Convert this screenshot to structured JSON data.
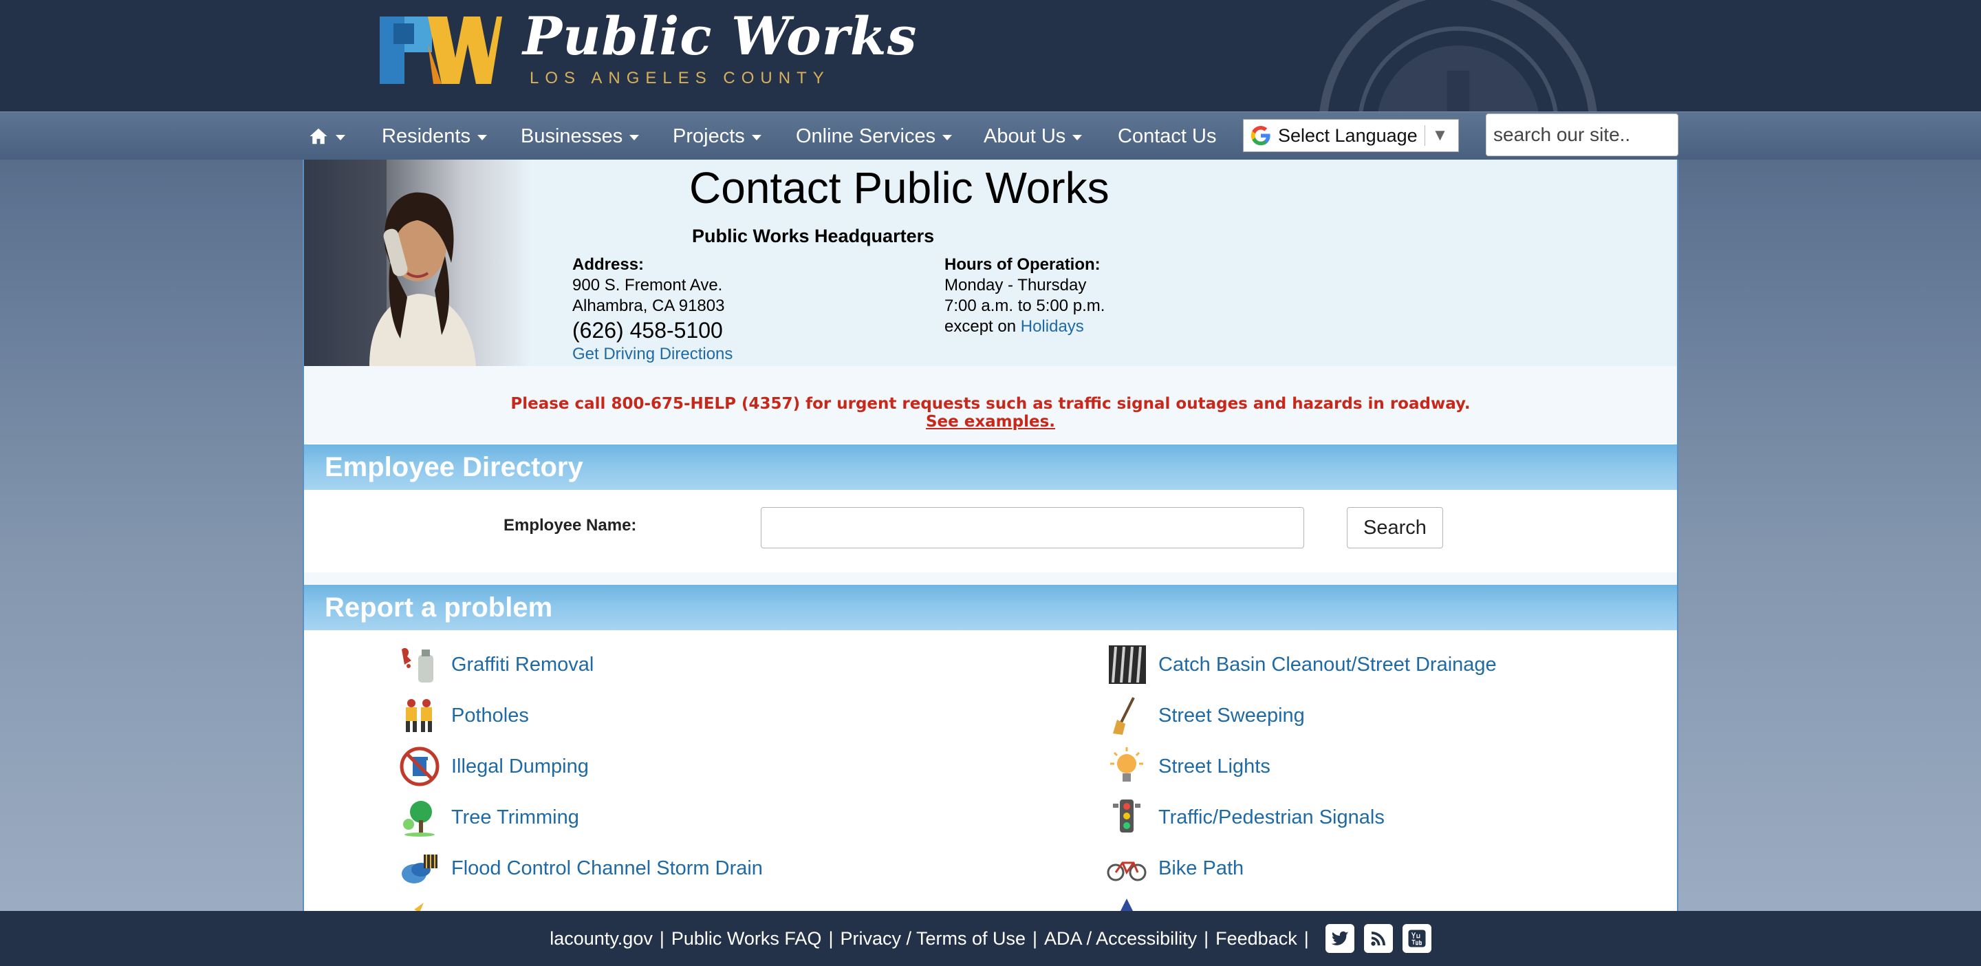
{
  "header": {
    "logo_title": "Public Works",
    "logo_subtitle": "LOS ANGELES COUNTY"
  },
  "nav": {
    "items": [
      {
        "label": "Residents"
      },
      {
        "label": "Businesses"
      },
      {
        "label": "Projects"
      },
      {
        "label": "Online Services"
      },
      {
        "label": "About Us"
      },
      {
        "label": "Contact Us"
      }
    ],
    "language_select": "Select Language",
    "search_placeholder": "search our site.."
  },
  "contact": {
    "title": "Contact Public Works",
    "hq": "Public Works Headquarters",
    "address_label": "Address:",
    "address_line1": "900 S. Fremont Ave.",
    "address_line2": "Alhambra, CA 91803",
    "phone": "(626) 458-5100",
    "directions_link": "Get Driving Directions",
    "hours_label": "Hours of Operation:",
    "hours_line1": "Monday - Thursday",
    "hours_line2": "7:00 a.m. to 5:00 p.m.",
    "hours_line3_prefix": "except on",
    "holidays_link": "Holidays"
  },
  "urgent": {
    "message": "Please call 800-675-HELP (4357) for urgent requests such as traffic signal outages and hazards in roadway.",
    "link": "See examples."
  },
  "employee_directory": {
    "heading": "Employee Directory",
    "name_label": "Employee Name:",
    "name_value": "",
    "search_button": "Search"
  },
  "report_problem": {
    "heading": "Report a problem",
    "left": [
      {
        "label": "Graffiti Removal",
        "icon": "graffiti-icon"
      },
      {
        "label": "Potholes",
        "icon": "pothole-workers-icon"
      },
      {
        "label": "Illegal Dumping",
        "icon": "no-dumping-icon"
      },
      {
        "label": "Tree Trimming",
        "icon": "tree-icon"
      },
      {
        "label": "Flood Control Channel Storm Drain",
        "icon": "storm-drain-icon"
      }
    ],
    "right": [
      {
        "label": "Catch Basin Cleanout/Street Drainage",
        "icon": "catch-basin-icon"
      },
      {
        "label": "Street Sweeping",
        "icon": "broom-icon"
      },
      {
        "label": "Street Lights",
        "icon": "light-bulb-icon"
      },
      {
        "label": "Traffic/Pedestrian Signals",
        "icon": "traffic-light-icon"
      },
      {
        "label": "Bike Path",
        "icon": "bicycle-icon"
      }
    ]
  },
  "footer": {
    "links": [
      "lacounty.gov",
      "Public Works FAQ",
      "Privacy / Terms of Use",
      "ADA / Accessibility",
      "Feedback"
    ],
    "social": [
      "twitter-icon",
      "rss-icon",
      "youtube-icon"
    ]
  },
  "colors": {
    "header_bg": "#243249",
    "link": "#1f6aa5",
    "urgent_red": "#c8281a",
    "section_blue": "#8fc8ec",
    "logo_gold": "#d7b05a"
  }
}
